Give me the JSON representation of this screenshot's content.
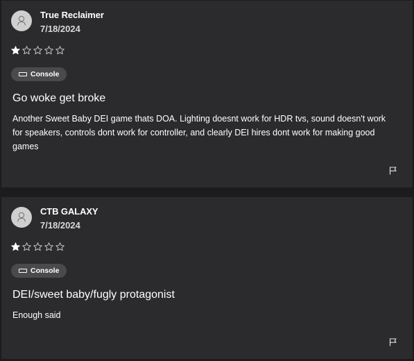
{
  "reviews": [
    {
      "user": "True Reclaimer",
      "date": "7/18/2024",
      "rating": 1,
      "max_rating": 5,
      "platform": "Console",
      "title": "Go woke get broke",
      "body": "Another Sweet Baby DEI game thats DOA. Lighting doesnt work for HDR tvs, sound doesn't work for speakers, controls dont work for controller, and clearly DEI hires dont work for making good games",
      "icons": {
        "avatar": "person-icon",
        "platform": "console-icon",
        "report": "flag-icon"
      }
    },
    {
      "user": "CTB GALAXY",
      "date": "7/18/2024",
      "rating": 1,
      "max_rating": 5,
      "platform": "Console",
      "title": "DEI/sweet baby/fugly protagonist",
      "body": "Enough said",
      "icons": {
        "avatar": "person-icon",
        "platform": "console-icon",
        "report": "flag-icon"
      }
    }
  ],
  "colors": {
    "page_background": "#1c1c1e",
    "card_background": "#2b2b2e",
    "badge_background": "#4a4a4d",
    "avatar_background": "#cfcfcf",
    "text": "#ffffff"
  }
}
